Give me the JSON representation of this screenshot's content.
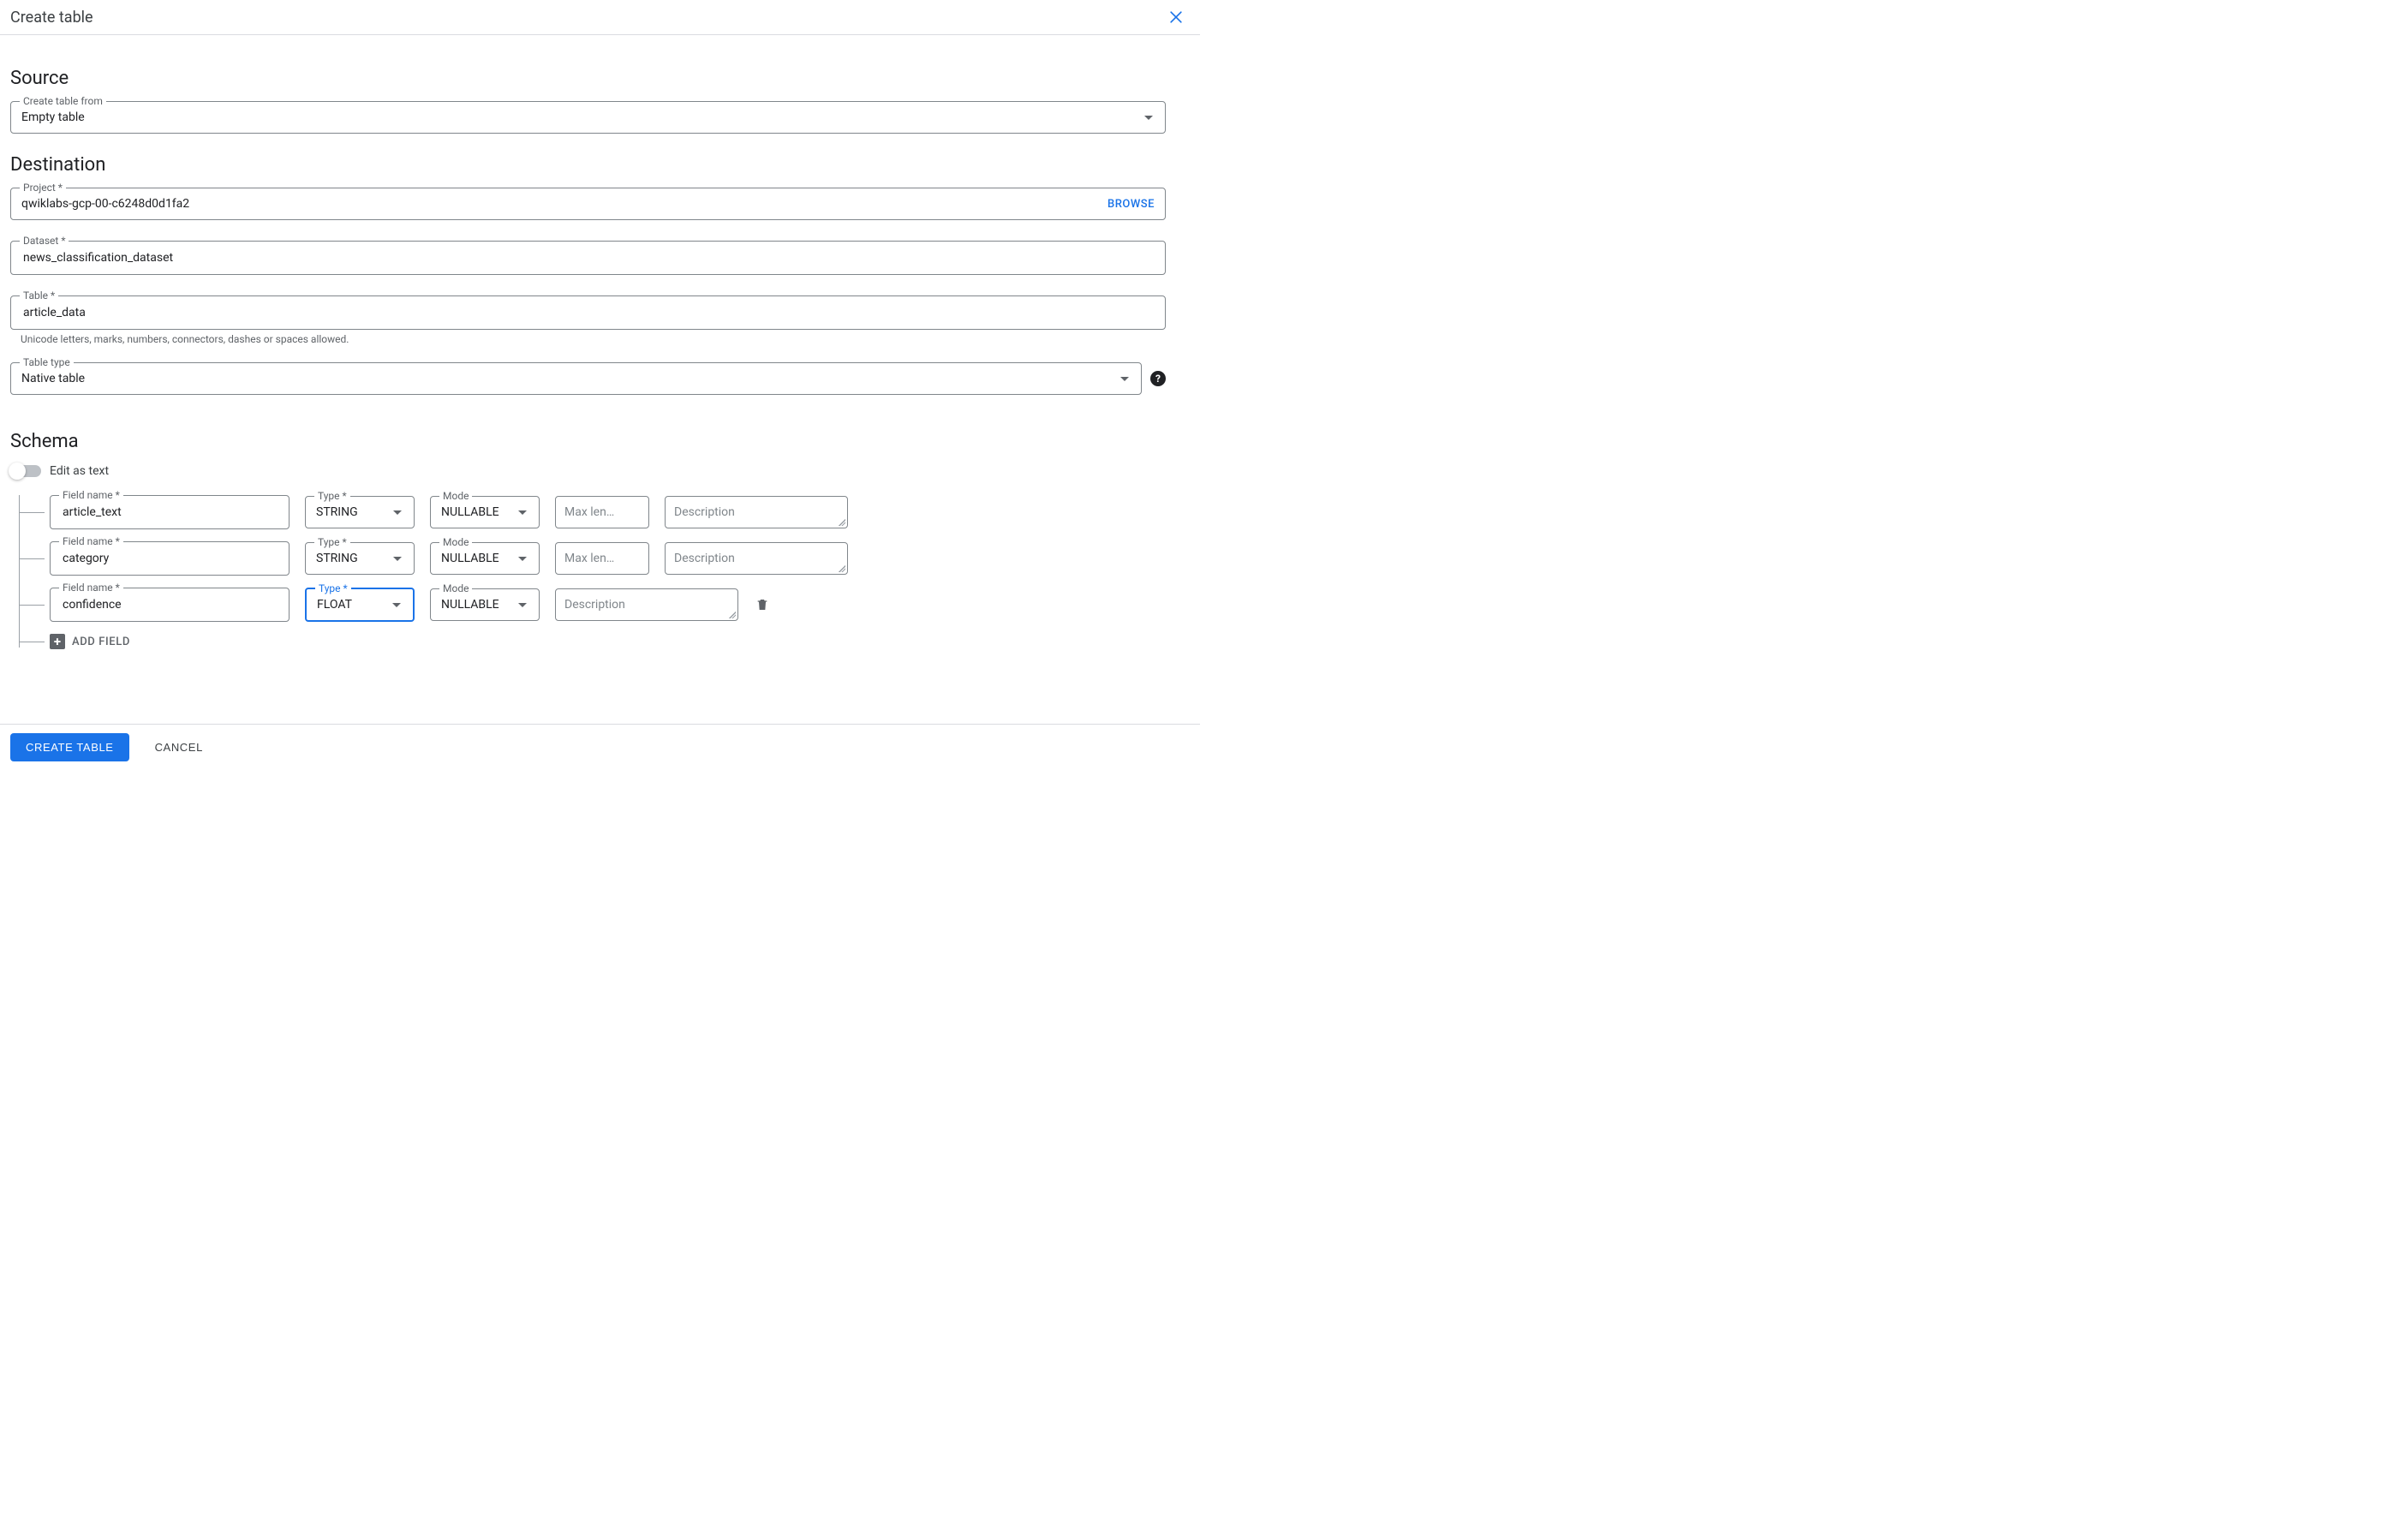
{
  "header": {
    "title": "Create table"
  },
  "source": {
    "heading": "Source",
    "create_from_label": "Create table from",
    "create_from_value": "Empty table"
  },
  "destination": {
    "heading": "Destination",
    "project_label": "Project *",
    "project_value": "qwiklabs-gcp-00-c6248d0d1fa2",
    "browse_label": "BROWSE",
    "dataset_label": "Dataset *",
    "dataset_value": "news_classification_dataset",
    "table_label": "Table *",
    "table_value": "article_data",
    "table_helper": "Unicode letters, marks, numbers, connectors, dashes or spaces allowed.",
    "table_type_label": "Table type",
    "table_type_value": "Native table"
  },
  "schema": {
    "heading": "Schema",
    "edit_as_text_label": "Edit as text",
    "field_name_label": "Field name *",
    "type_label": "Type *",
    "mode_label": "Mode",
    "maxlen_placeholder": "Max len…",
    "description_placeholder": "Description",
    "add_field_label": "ADD FIELD",
    "rows": [
      {
        "name": "article_text",
        "type": "STRING",
        "mode": "NULLABLE",
        "show_maxlen": true,
        "show_delete": false,
        "type_active": false
      },
      {
        "name": "category",
        "type": "STRING",
        "mode": "NULLABLE",
        "show_maxlen": true,
        "show_delete": false,
        "type_active": false
      },
      {
        "name": "confidence",
        "type": "FLOAT",
        "mode": "NULLABLE",
        "show_maxlen": false,
        "show_delete": true,
        "type_active": true
      }
    ]
  },
  "footer": {
    "create_label": "CREATE TABLE",
    "cancel_label": "CANCEL"
  }
}
